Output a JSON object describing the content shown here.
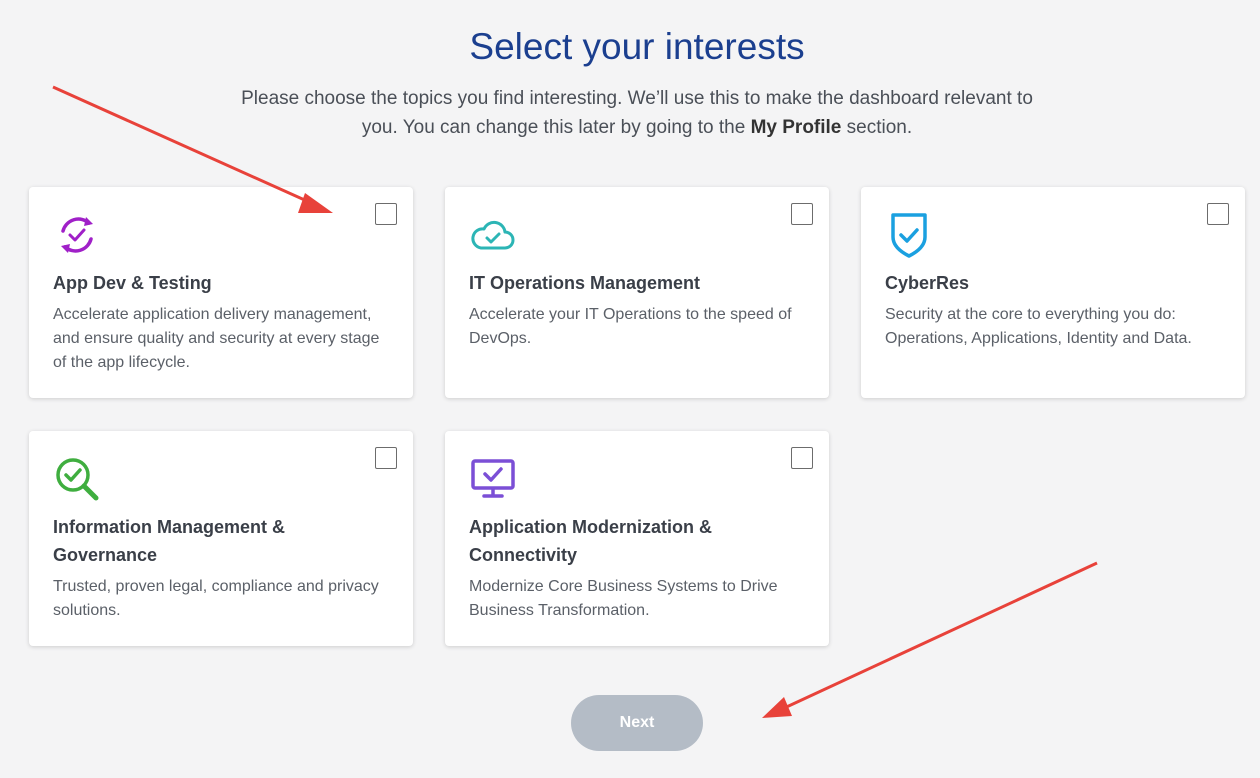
{
  "header": {
    "title": "Select your interests",
    "subtitle_part1": "Please choose the topics you find interesting. We’ll use this to make the dashboard relevant to you. You can change this later by going to the ",
    "subtitle_bold": "My Profile",
    "subtitle_part2": " section."
  },
  "cards": [
    {
      "title": "App Dev & Testing",
      "description": "Accelerate application delivery management, and ensure quality and security at every stage of the app lifecycle.",
      "icon": "cycle-check-icon",
      "color": "#a020c8",
      "checked": false
    },
    {
      "title": "IT Operations Management",
      "description": "Accelerate your IT Operations to the speed of DevOps.",
      "icon": "cloud-check-icon",
      "color": "#2cb5b5",
      "checked": false
    },
    {
      "title": "CyberRes",
      "description": "Security at the core to everything you do: Operations, Applications, Identity and Data.",
      "icon": "shield-check-icon",
      "color": "#1aa0e0",
      "checked": false
    },
    {
      "title": "Information Management & Governance",
      "description": "Trusted, proven legal, compliance and privacy solutions.",
      "icon": "magnifier-check-icon",
      "color": "#3fae3f",
      "checked": false
    },
    {
      "title": "Application Modernization & Connectivity",
      "description": "Modernize Core Business Systems to Drive Business Transformation.",
      "icon": "monitor-check-icon",
      "color": "#7b4fd6",
      "checked": false
    }
  ],
  "footer": {
    "next_label": "Next"
  },
  "colors": {
    "title": "#1b3f8f",
    "button_disabled": "#b4bcc6",
    "annotation_arrow": "#e8423a"
  }
}
